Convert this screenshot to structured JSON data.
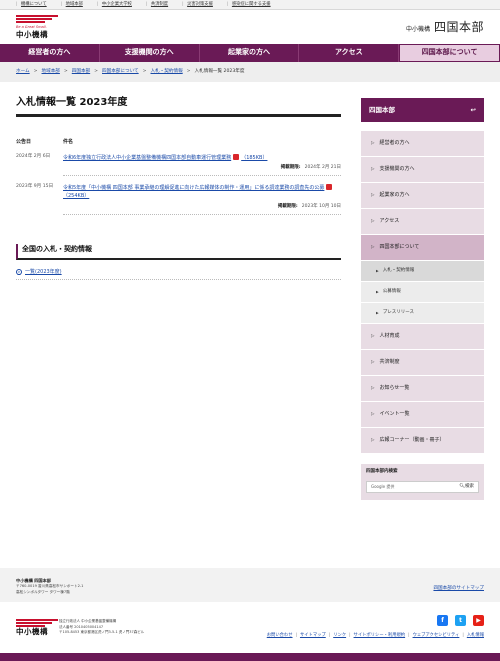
{
  "utility_links": [
    "機構について",
    "地域本部",
    "中小企業大学校",
    "共済制度",
    "災害対策支援",
    "感染症に関する支援"
  ],
  "header": {
    "logo_tagline": "Be a Great Small.",
    "logo_text": "中小機構",
    "brand_small": "中小機構",
    "brand_big": "四国本部"
  },
  "nav": [
    "経営者の方へ",
    "支援機関の方へ",
    "起業家の方へ",
    "アクセス",
    "四国本部について"
  ],
  "breadcrumb": [
    "ホーム",
    "地域本部",
    "四国本部",
    "四国本部について",
    "入札・契約情報",
    "入札情報一覧 2023年度"
  ],
  "main": {
    "title": "入札情報一覧 2023年度",
    "col_date": "公告日",
    "col_name": "件名",
    "rows": [
      {
        "date": "2024年 2月 6日",
        "title": "令和6年度独立行政法人中小企業基盤整備機構四国本部自動車運行管理業務",
        "size": "（185KB）",
        "period_label": "掲載期限:",
        "period_value": "2024年 2月 21日"
      },
      {
        "date": "2023年 9月 15日",
        "title": "令和5年度「中小機構 四国本部 事業承継の理解促進に向けた広報媒体の制作・運用」に係る調達業務の調査先の公募",
        "size": "（254KB）",
        "period_label": "掲載期限:",
        "period_value": "2023年 10月 10日"
      }
    ],
    "sub_title": "全国の入札・契約情報",
    "list_link": "一覧(2023年度)"
  },
  "sidebar": {
    "title": "四国本部",
    "items_top": [
      "経営者の方へ",
      "支援機関の方へ",
      "起業家の方へ",
      "アクセス",
      "四国本部について"
    ],
    "sub_items": [
      "入札・契約情報",
      "公募情報",
      "プレスリリース"
    ],
    "items_bottom": [
      "人材育成",
      "共済制度",
      "お知らせ一覧",
      "イベント一覧",
      "広報コーナー（動画・冊子）"
    ],
    "search_title": "四国本部内検索",
    "search_placeholder": "Google 提供",
    "search_button": "検索"
  },
  "footer": {
    "org_name": "中小機構 四国本部",
    "address_1": "〒760-0019 香川県高松市サンポート2-1",
    "address_2": "高松シンボルタワー タワー棟7階",
    "sitemap_link": "四国本部のサイトマップ",
    "logo_text": "中小機構",
    "info_1": "独立行政法人 中小企業基盤整備機構",
    "info_2": "法人番号 2010405004147",
    "info_3": "〒105-8453 東京都港区虎ノ門3-5-1 虎ノ門37森ビル",
    "links": [
      "お問い合わせ",
      "サイトマップ",
      "リンク",
      "サイトポリシー・利用規約",
      "ウェブアクセシビリティ",
      "入札情報"
    ]
  },
  "colors": {
    "brand_purple": "#6a1a56",
    "logo_red": "#c8102e",
    "link_blue": "#1a4aa8"
  }
}
